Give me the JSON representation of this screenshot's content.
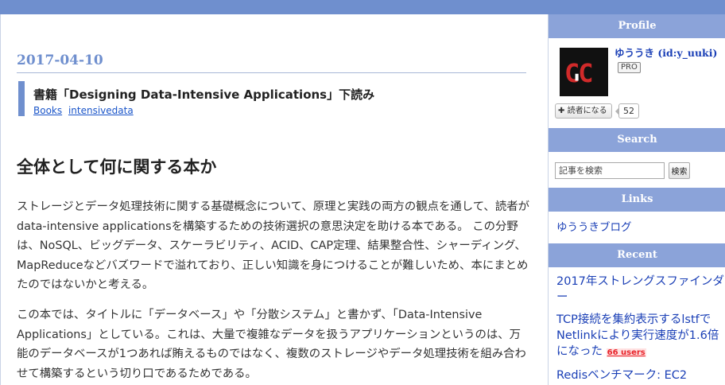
{
  "main": {
    "date": "2017-04-10",
    "entry_title": "書籍「Designing Data-Intensive Applications」下読み",
    "categories": [
      "Books",
      "intensivedata"
    ],
    "section_heading": "全体として何に関する本か",
    "paragraphs": [
      "ストレージとデータ処理技術に関する基礎概念について、原理と実践の両方の観点を通して、読者がdata-intensive applicationsを構築するための技術選択の意思決定を助ける本である。 この分野は、NoSQL、ビッグデータ、スケーラビリティ、ACID、CAP定理、結果整合性、シャーディング、MapReduceなどバズワードで溢れており、正しい知識を身につけることが難しいため、本にまとめたのではないかと考える。",
      "この本では、タイトルに「データベース」や「分散システム」と書かず、「Data-Intensive Applications」としている。これは、大量で複雑なデータを扱うアプリケーションというのは、万能のデータベースが1つあれば賄えるものではなく、複数のストレージやデータ処理技術を組み合わせて構築するという切り口であるためである。"
    ]
  },
  "sidebar": {
    "profile": {
      "heading": "Profile",
      "avatar_text": "C'C",
      "name": "ゆううき (id:y_uuki)",
      "badge": "PRO",
      "follow_label": "読者になる",
      "follow_count": "52"
    },
    "search": {
      "heading": "Search",
      "placeholder": "記事を検索",
      "button_label": "検索"
    },
    "links": {
      "heading": "Links",
      "items": [
        "ゆううきブログ"
      ]
    },
    "recent": {
      "heading": "Recent",
      "items": [
        {
          "title": "2017年ストレングスファインダー",
          "users": ""
        },
        {
          "title": "TCP接続を集約表示するlstfでNetlinkにより実行速度が1.6倍になった",
          "users": "66 users"
        },
        {
          "title": "Redisベンチマーク: EC2 ",
          "users": ""
        }
      ]
    }
  },
  "colors": {
    "accent": "#6f8fce",
    "module_header": "#8ba3d9",
    "link": "#1a3fb6",
    "badge_red": "#e8232a"
  },
  "icons": {
    "follow": "plus-icon"
  }
}
